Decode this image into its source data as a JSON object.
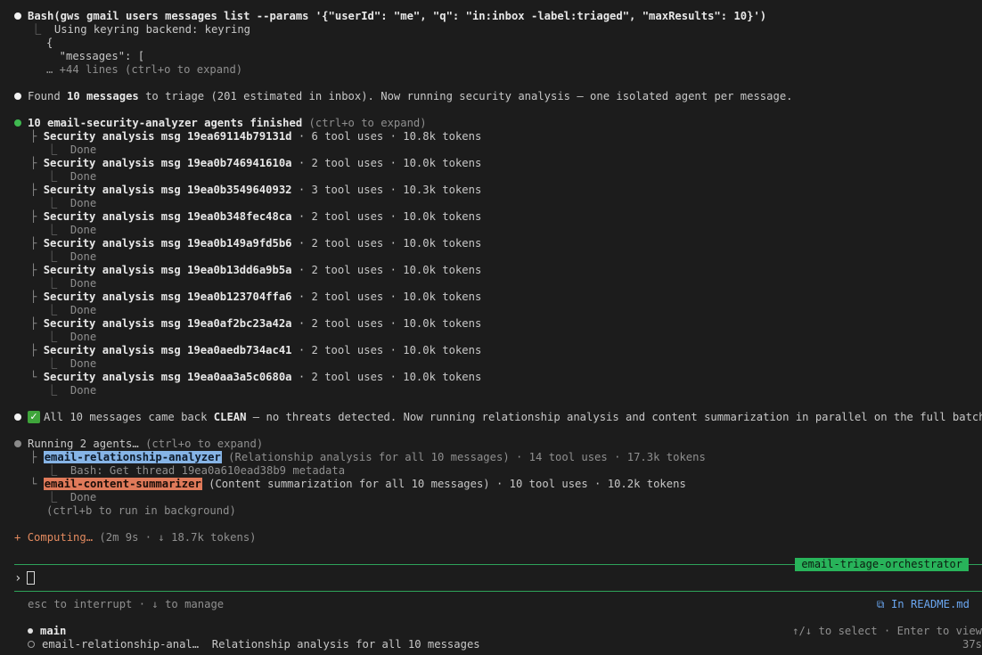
{
  "bash_block": {
    "command": "Bash(gws gmail users messages list --params '{\"userId\": \"me\", \"q\": \"in:inbox -label:triaged\", \"maxResults\": 10}')",
    "output_line1": "Using keyring backend: keyring",
    "output_line2": "{",
    "output_line3": "  \"messages\": [",
    "output_more": "… +44 lines (ctrl+o to expand)"
  },
  "found_line": {
    "prefix": "Found ",
    "count": "10 messages",
    "suffix": " to triage (201 estimated in inbox). Now running security analysis — one isolated agent per message."
  },
  "agents_finished": {
    "label": "10 email-security-analyzer agents finished",
    "hint": " (ctrl+o to expand)",
    "items": [
      {
        "title": "Security analysis msg 19ea69114b79131d",
        "meta": " · 6 tool uses · 10.8k tokens",
        "status": "Done"
      },
      {
        "title": "Security analysis msg 19ea0b746941610a",
        "meta": " · 2 tool uses · 10.0k tokens",
        "status": "Done"
      },
      {
        "title": "Security analysis msg 19ea0b3549640932",
        "meta": " · 3 tool uses · 10.3k tokens",
        "status": "Done"
      },
      {
        "title": "Security analysis msg 19ea0b348fec48ca",
        "meta": " · 2 tool uses · 10.0k tokens",
        "status": "Done"
      },
      {
        "title": "Security analysis msg 19ea0b149a9fd5b6",
        "meta": " · 2 tool uses · 10.0k tokens",
        "status": "Done"
      },
      {
        "title": "Security analysis msg 19ea0b13dd6a9b5a",
        "meta": " · 2 tool uses · 10.0k tokens",
        "status": "Done"
      },
      {
        "title": "Security analysis msg 19ea0b123704ffa6",
        "meta": " · 2 tool uses · 10.0k tokens",
        "status": "Done"
      },
      {
        "title": "Security analysis msg 19ea0af2bc23a42a",
        "meta": " · 2 tool uses · 10.0k tokens",
        "status": "Done"
      },
      {
        "title": "Security analysis msg 19ea0aedb734ac41",
        "meta": " · 2 tool uses · 10.0k tokens",
        "status": "Done"
      },
      {
        "title": "Security analysis msg 19ea0aa3a5c0680a",
        "meta": " · 2 tool uses · 10.0k tokens",
        "status": "Done"
      }
    ]
  },
  "clean_line": {
    "prefix": "All 10 messages came back ",
    "clean": "CLEAN",
    "suffix": " — no threats detected. Now running relationship analysis and content summarization in parallel on the full batch."
  },
  "running": {
    "label": "Running 2 agents…",
    "hint": " (ctrl+o to expand)",
    "agent1_name": "email-relationship-analyzer",
    "agent1_desc": " (Relationship analysis for all 10 messages)",
    "agent1_meta": " · 14 tool uses · 17.3k tokens",
    "agent1_sub": "Bash: Get thread 19ea0a610ead38b9 metadata",
    "agent2_name": "email-content-summarizer",
    "agent2_desc": " (Content summarization for all 10 messages)",
    "agent2_meta": " · 10 tool uses · 10.2k tokens",
    "agent2_sub": "Done",
    "background_hint": "(ctrl+b to run in background)"
  },
  "computing": {
    "star": "+",
    "label": "Computing…",
    "meta": " (2m 9s · ↓ 18.7k tokens)"
  },
  "orchestrator_badge": "email-triage-orchestrator",
  "prompt_symbol": "›",
  "footer": {
    "shortcuts": "esc to interrupt · ↓ to manage",
    "readme": "In README.md",
    "branch_main": "main",
    "select_hint": "↑/↓ to select · Enter to view",
    "task_name": "email-relationship-anal…",
    "task_desc": "  Relationship analysis for all 10 messages",
    "elapsed": "37s"
  },
  "colors": {
    "background": "#1c1c1c",
    "accent_green": "#28b35a",
    "agent_blue": "#86b4e6",
    "agent_orange": "#e07a5a"
  }
}
